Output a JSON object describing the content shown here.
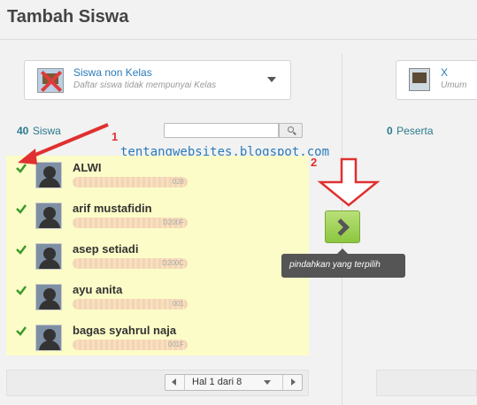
{
  "page": {
    "title": "Tambah Siswa"
  },
  "left_panel": {
    "selector": {
      "title": "Siswa non Kelas",
      "subtitle": "Daftar siswa tidak mempunyai Kelas"
    },
    "count": {
      "value": "40",
      "label": "Siswa"
    },
    "search": {
      "placeholder": "",
      "value": ""
    },
    "students": [
      {
        "name": "ALWI",
        "id_tail": "028",
        "checked": true
      },
      {
        "name": "arif mustafidin",
        "id_tail": "D200F",
        "checked": true
      },
      {
        "name": "asep setiadi",
        "id_tail": "D200C",
        "checked": true
      },
      {
        "name": "ayu anita",
        "id_tail": "001",
        "checked": true
      },
      {
        "name": "bagas syahrul naja",
        "id_tail": "001F",
        "checked": true
      }
    ],
    "pager": {
      "label": "Hal 1 dari 8"
    }
  },
  "right_panel": {
    "selector": {
      "title": "X",
      "subtitle": "Umum"
    },
    "count": {
      "value": "0",
      "label": "Peserta"
    }
  },
  "move_button": {
    "tooltip": "pindahkan yang terpilih"
  },
  "annotations": {
    "watermark": "tentangwebsites.blogspot.com",
    "marker_1": "1",
    "marker_2": "2"
  },
  "colors": {
    "accent": "#2b7bb9",
    "list_bg": "#fcfcc8",
    "move_button": "#8cc63f",
    "annotation": "#e03030"
  }
}
